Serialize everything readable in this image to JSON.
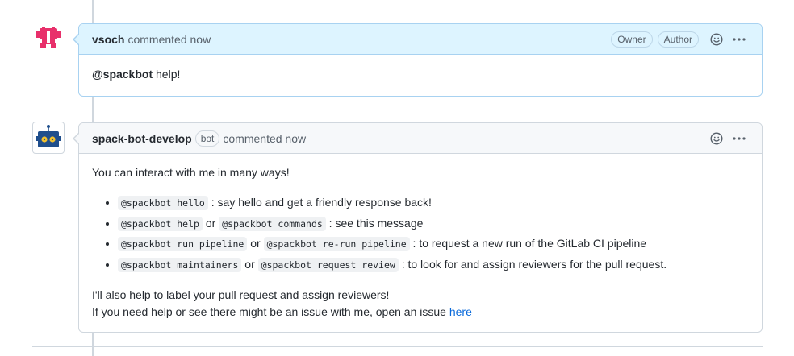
{
  "comment1": {
    "author": "vsoch",
    "action": "commented now",
    "badges": [
      "Owner",
      "Author"
    ],
    "mention": "@spackbot",
    "text": " help!"
  },
  "comment2": {
    "author": "spack-bot-develop",
    "bot_label": "bot",
    "action": "commented now",
    "intro": "You can interact with me in many ways!",
    "items": [
      {
        "code1": "@spackbot hello",
        "sep": "",
        "code2": "",
        "text": " : say hello and get a friendly response back!"
      },
      {
        "code1": "@spackbot help",
        "sep": " or ",
        "code2": "@spackbot commands",
        "text": " : see this message"
      },
      {
        "code1": "@spackbot run pipeline",
        "sep": " or ",
        "code2": "@spackbot re-run pipeline",
        "text": " : to request a new run of the GitLab CI pipeline"
      },
      {
        "code1": "@spackbot maintainers",
        "sep": " or ",
        "code2": "@spackbot request review",
        "text": " : to look for and assign reviewers for the pull request."
      }
    ],
    "outro_line1": "I'll also help to label your pull request and assign reviewers!",
    "outro_line2": "If you need help or see there might be an issue with me, open an issue ",
    "link_text": "here"
  },
  "colors": {
    "link": "#0969da",
    "own_header_bg": "#ddf4ff",
    "avatar_pink": "#e8306b",
    "robot_blue": "#1f4e8c",
    "robot_yellow": "#f2c12e"
  },
  "icons": [
    "smiley-icon",
    "kebab-menu-icon",
    "identicon-avatar",
    "robot-avatar"
  ]
}
